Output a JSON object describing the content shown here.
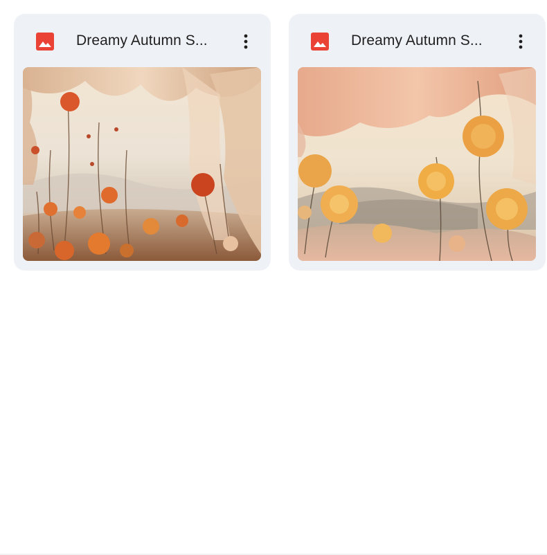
{
  "files": [
    {
      "title": "Dreamy Autumn S...",
      "icon": "image-file-icon",
      "menu_icon": "more-vert-icon",
      "thumbnail": "autumn-poppies-drapes-image"
    },
    {
      "title": "Dreamy Autumn S...",
      "icon": "image-file-icon",
      "menu_icon": "more-vert-icon",
      "thumbnail": "autumn-marigolds-drapes-image"
    }
  ],
  "colors": {
    "card_background": "#eef1f6",
    "file_icon": "#ea4335",
    "title_text": "#1f1f1f"
  }
}
